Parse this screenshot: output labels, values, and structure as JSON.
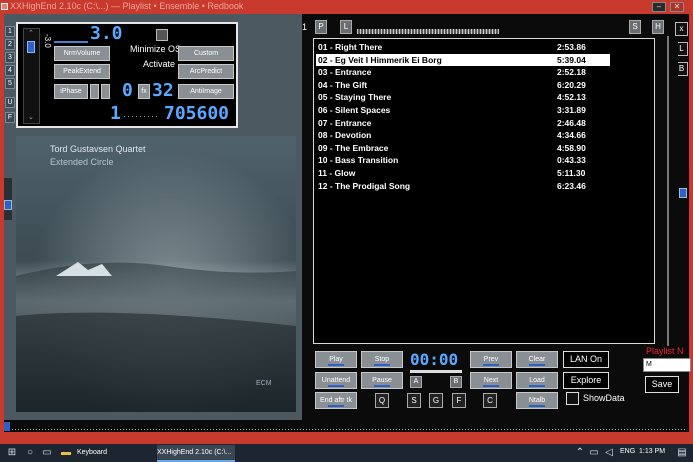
{
  "window": {
    "title": "XXHighEnd 2.10c (C:\\...) — Playlist • Ensemble • Redbook",
    "minimize": "–",
    "close": "✕"
  },
  "left_nums": [
    "1",
    "2",
    "3",
    "4",
    "5",
    "U",
    "F"
  ],
  "control_panel": {
    "volume_value": "-3.0",
    "volume_lcd": "3.0",
    "minimize_os": "Minimize OS",
    "activate": "Activate",
    "buttons": {
      "nrm_volume": "NrmVolume",
      "peak_extend": "PeakExtend",
      "iphase": "iPhase",
      "custom": "Custom",
      "arc_predict": "ArcPredict",
      "antiimage": "AntiImage",
      "fx": "fx"
    },
    "lcd_zero": "0",
    "lcd_32": "32",
    "lcd_1": "1",
    "lcd_rate": "705600"
  },
  "cover": {
    "artist": "Tord Gustavsen Quartet",
    "album": "Extended Circle",
    "label": "ECM"
  },
  "playlist_top": {
    "number": "1",
    "p_btn": "P",
    "l_btn": "L",
    "s_btn": "S",
    "h_btn": "H"
  },
  "side_buttons": {
    "x": "x",
    "l": "L",
    "b": "B"
  },
  "tracks": [
    {
      "name": "01 - Right There",
      "time": "2:53.86"
    },
    {
      "name": "02 - Eg Veit I Himmerik Ei Borg",
      "time": "5:39.04"
    },
    {
      "name": "03 - Entrance",
      "time": "2:52.18"
    },
    {
      "name": "04 - The Gift",
      "time": "6:20.29"
    },
    {
      "name": "05 - Staying There",
      "time": "4:52.13"
    },
    {
      "name": "06 - Silent Spaces",
      "time": "3:31.89"
    },
    {
      "name": "07 - Entrance",
      "time": "2:46.48"
    },
    {
      "name": "08 - Devotion",
      "time": "4:34.66"
    },
    {
      "name": "09 - The Embrace",
      "time": "4:58.90"
    },
    {
      "name": "10 - Bass Transition",
      "time": "0:43.33"
    },
    {
      "name": "11 - Glow",
      "time": "5:11.30"
    },
    {
      "name": "12 - The Prodigal Song",
      "time": "6:23.46"
    }
  ],
  "selected_track_index": 1,
  "transport": {
    "play": "Play",
    "stop": "Stop",
    "unattend": "Unattend",
    "pause": "Pause",
    "end_after_tk": "End aftr tk",
    "prev": "Prev",
    "clear": "Clear",
    "next": "Next",
    "load": "Load",
    "ntalb": "Ntalb",
    "time_lcd": "00:00",
    "a": "A",
    "b": "B",
    "q": "Q",
    "s": "S",
    "g": "G",
    "f": "F",
    "c": "C"
  },
  "lan_panel": {
    "lan_on": "LAN On",
    "explore": "Explore",
    "show_data": "ShowData",
    "playlist_label": "Playlist N",
    "save": "Save",
    "playlist_value": "M"
  },
  "taskbar": {
    "keyboard": "Keyboard",
    "app": "XXHighEnd 2.10c (C:\\...",
    "lang": "ENG",
    "time": "1:13 PM"
  }
}
